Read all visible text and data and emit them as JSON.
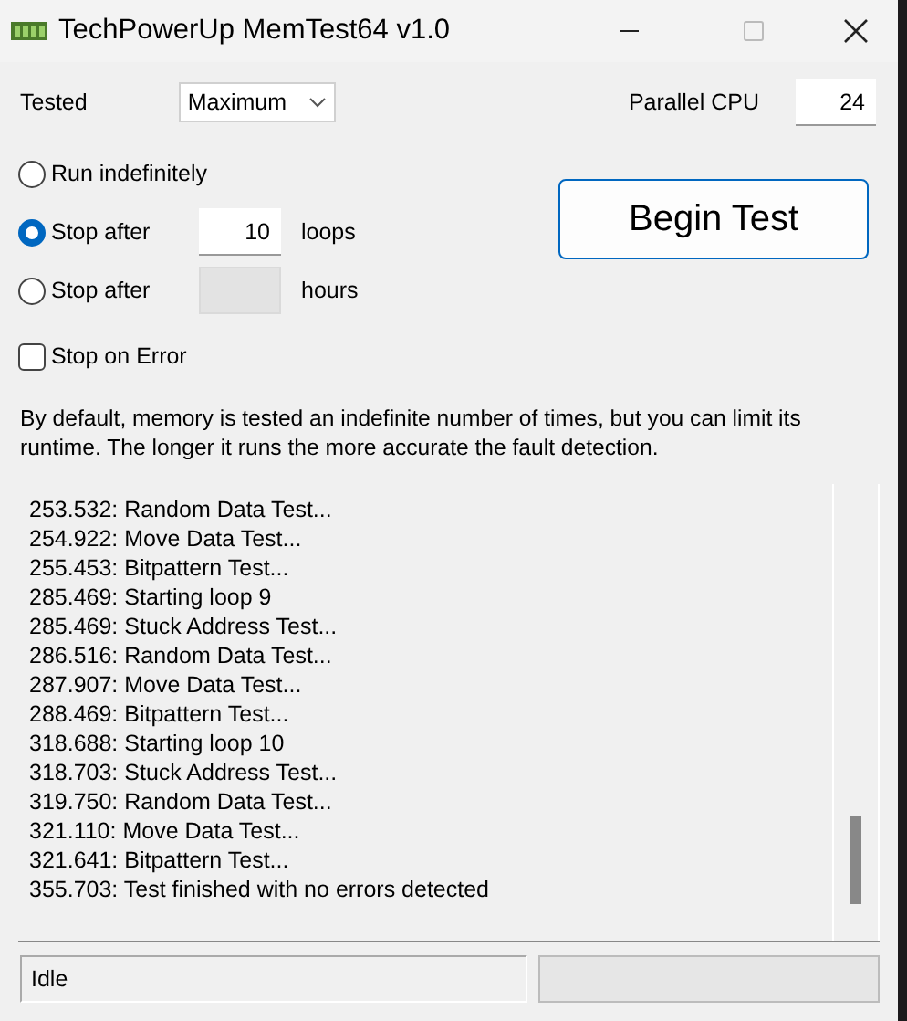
{
  "window": {
    "title": "TechPowerUp MemTest64 v1.0"
  },
  "tested": {
    "label": "Tested",
    "value": "Maximum"
  },
  "parallel_cpu": {
    "label": "Parallel CPU",
    "value": "24"
  },
  "options": [
    {
      "kind": "radio",
      "label": "Run indefinitely",
      "selected": false
    },
    {
      "kind": "radio",
      "label": "Stop after",
      "selected": true,
      "value": "10",
      "unit": "loops",
      "disabled": false
    },
    {
      "kind": "radio",
      "label": "Stop after",
      "selected": false,
      "unit": "hours",
      "disabled": true
    }
  ],
  "stop_on_error": {
    "label": "Stop on Error",
    "checked": false
  },
  "begin_button": "Begin Test",
  "description": "By default, memory is tested an indefinite number of times, but you can limit its runtime. The longer it runs the more accurate the fault detection.",
  "log": [
    "253.532: Random Data Test...",
    "254.922: Move Data Test...",
    "255.453: Bitpattern Test...",
    "285.469: Starting loop 9",
    "285.469: Stuck Address Test...",
    "286.516: Random Data Test...",
    "287.907: Move Data Test...",
    "288.469: Bitpattern Test...",
    "318.688: Starting loop 10",
    "318.703: Stuck Address Test...",
    "319.750: Random Data Test...",
    "321.110: Move Data Test...",
    "321.641: Bitpattern Test...",
    "355.703: Test finished with no errors detected"
  ],
  "status_bar": {
    "text": "Idle",
    "progress": {
      "level": 0
    }
  }
}
